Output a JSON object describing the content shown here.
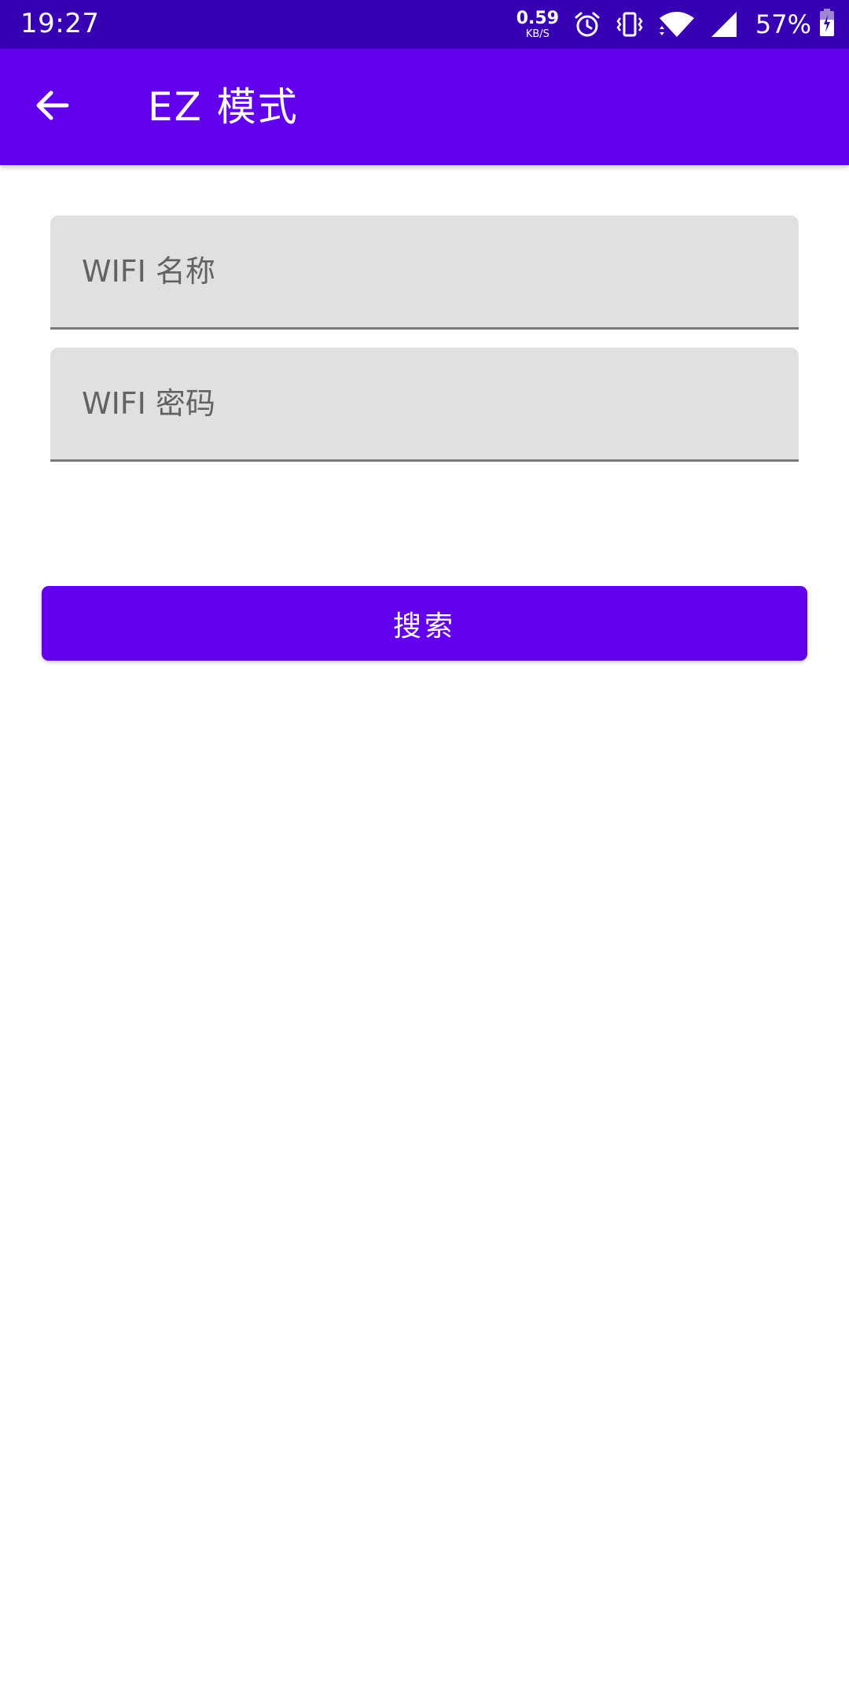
{
  "status_bar": {
    "time": "19:27",
    "net_speed_value": "0.59",
    "net_speed_unit": "KB/S",
    "battery_percent": "57%",
    "icons": [
      "alarm-icon",
      "vibrate-icon",
      "wifi-icon",
      "cell-signal-icon",
      "battery-charging-icon"
    ]
  },
  "app_bar": {
    "title": "EZ 模式",
    "back_icon": "arrow-left-icon"
  },
  "form": {
    "ssid_placeholder": "WIFI 名称",
    "ssid_value": "",
    "password_placeholder": "WIFI 密码",
    "password_value": "",
    "search_label": "搜索"
  },
  "colors": {
    "status_bar": "#3700b3",
    "primary": "#6200ee",
    "field_bg": "#e0e0e0",
    "field_underline": "#7b7b7b"
  }
}
